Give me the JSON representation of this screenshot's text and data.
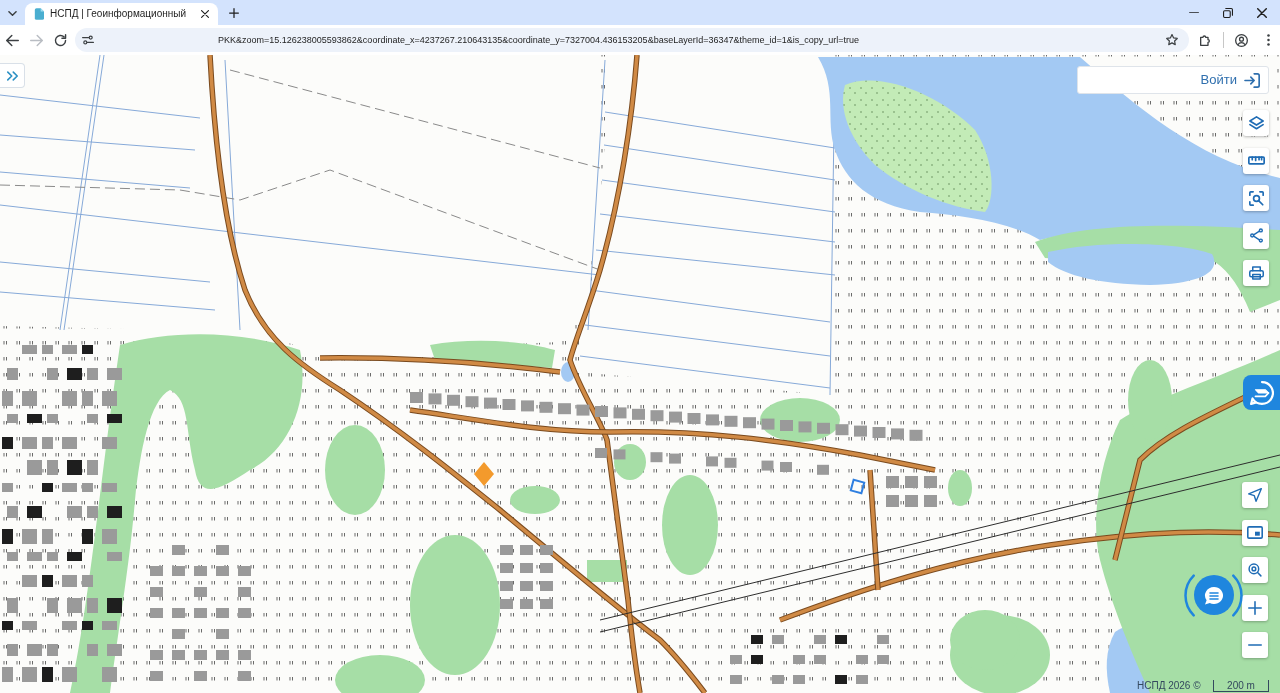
{
  "browser": {
    "tabs": [
      {
        "title": "НСПД | Геоинформационный",
        "selected": true
      }
    ],
    "nav_buttons": [
      {
        "kind": "back",
        "disabled": false
      },
      {
        "kind": "forward",
        "disabled": true
      },
      {
        "kind": "reload",
        "disabled": false
      }
    ],
    "address_bar": {
      "url": "PKK&zoom=15.126238005593862&coordinate_x=4237267.210643135&coordinate_y=7327004.436153205&baseLayerId=36347&theme_id=1&is_copy_url=true"
    }
  },
  "map": {
    "login_button": {
      "label": "Войти"
    },
    "top_tools": [
      {
        "kind": "layers"
      },
      {
        "kind": "ruler"
      },
      {
        "kind": "area_search"
      },
      {
        "kind": "share"
      },
      {
        "kind": "print"
      }
    ],
    "bottom_tools": [
      {
        "kind": "navigate"
      },
      {
        "kind": "panel"
      },
      {
        "kind": "location_search"
      },
      {
        "kind": "zoom_in"
      },
      {
        "kind": "zoom_out"
      }
    ],
    "attribution": "НСПД 2026 ©",
    "scale": "200 m"
  }
}
